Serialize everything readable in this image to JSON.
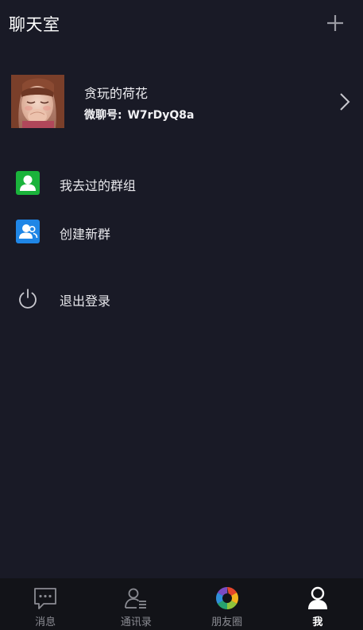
{
  "header": {
    "title": "聊天室",
    "add_icon": "plus-icon"
  },
  "profile": {
    "name": "贪玩的荷花",
    "id_label": "微聊号:",
    "id_value": "W7rDyQ8a",
    "arrow_icon": "chevron-right-icon"
  },
  "menu": {
    "groups_label": "我去过的群组",
    "create_label": "创建新群",
    "logout_label": "退出登录"
  },
  "tabs": [
    {
      "label": "消息",
      "icon": "chat-bubble-icon",
      "active": false
    },
    {
      "label": "通讯录",
      "icon": "contacts-icon",
      "active": false
    },
    {
      "label": "朋友圈",
      "icon": "moments-aperture-icon",
      "active": false
    },
    {
      "label": "我",
      "icon": "profile-icon",
      "active": true
    }
  ],
  "colors": {
    "background": "#191a26",
    "tabbar": "#121318",
    "green_icon": "#1ab33b",
    "blue_icon": "#1f86e6",
    "inactive_tab": "#8b8c93",
    "active_tab": "#ffffff"
  }
}
